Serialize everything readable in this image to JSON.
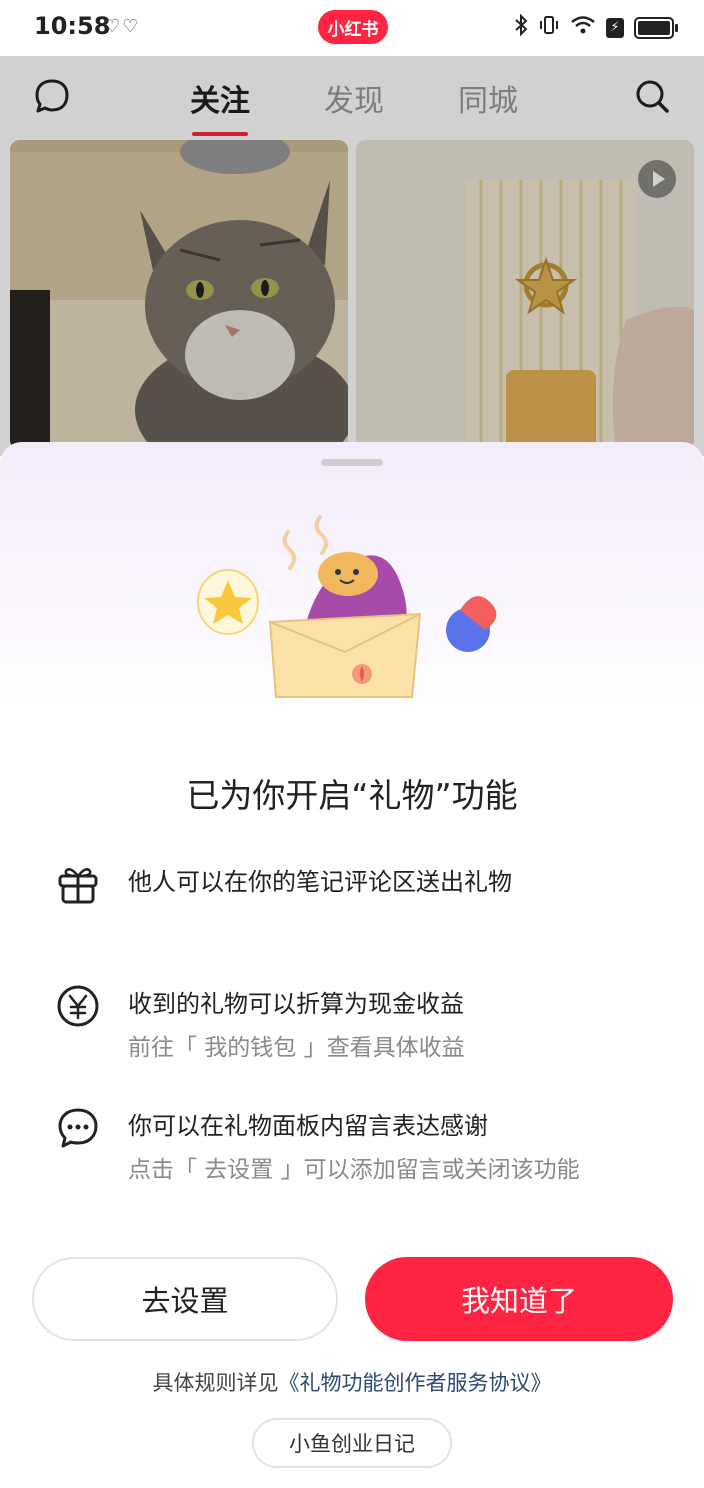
{
  "status_bar": {
    "time": "10:58",
    "app_badge": "小红书",
    "battery_charge_glyph": "⚡"
  },
  "nav": {
    "tabs": [
      {
        "label": "关注",
        "active": true
      },
      {
        "label": "发现",
        "active": false
      },
      {
        "label": "同城",
        "active": false
      }
    ],
    "left_icon": "message-bubble-icon",
    "right_icon": "search-icon"
  },
  "feed": {
    "cards": [
      {
        "icon": "cat-photo"
      },
      {
        "icon": "keychain-video",
        "has_play": true
      }
    ]
  },
  "sheet": {
    "title": "已为你开启“礼物”功能",
    "features": [
      {
        "icon": "gift-icon",
        "main": "他人可以在你的笔记评论区送出礼物",
        "sub": ""
      },
      {
        "icon": "yen-icon",
        "main": "收到的礼物可以折算为现金收益",
        "sub": "前往「 我的钱包 」查看具体收益"
      },
      {
        "icon": "chat-bubble-icon",
        "main": "你可以在礼物面板内留言表达感谢",
        "sub": "点击「 去设置 」可以添加留言或关闭该功能"
      }
    ],
    "buttons": {
      "settings": "去设置",
      "ok": "我知道了"
    },
    "rules": {
      "prefix": "具体规则详见",
      "link": "《礼物功能创作者服务协议》"
    },
    "watermark": "小鱼创业日记"
  },
  "colors": {
    "brand_red": "#ff2442",
    "link_blue": "#2b4a72"
  }
}
